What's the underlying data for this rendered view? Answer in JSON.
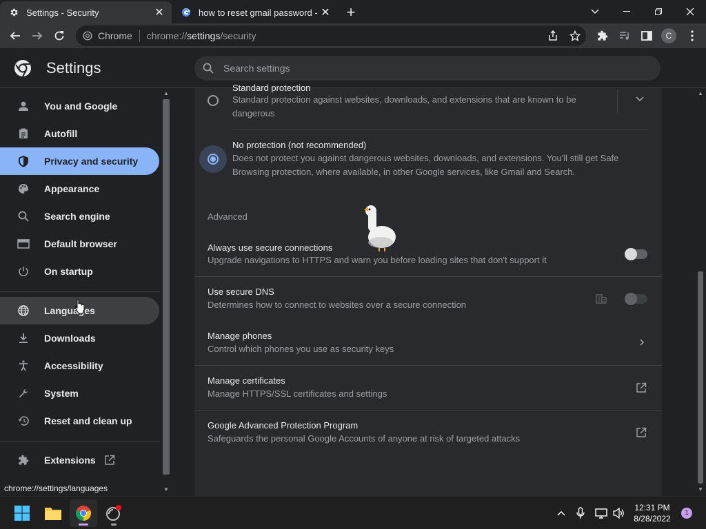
{
  "tabs": [
    {
      "title": "Settings - Security",
      "icon": "gear-icon"
    },
    {
      "title": "how to reset gmail password - Go",
      "icon": "google-icon"
    }
  ],
  "omnibox": {
    "site": "Chrome",
    "url_prefix": "chrome://",
    "url_host": "settings",
    "url_path": "/security"
  },
  "profile": {
    "initial": "C"
  },
  "header": {
    "title": "Settings",
    "search_placeholder": "Search settings"
  },
  "sidebar": {
    "items": [
      {
        "label": "You and Google",
        "icon": "person-icon"
      },
      {
        "label": "Autofill",
        "icon": "clipboard-icon"
      },
      {
        "label": "Privacy and security",
        "icon": "shield-icon"
      },
      {
        "label": "Appearance",
        "icon": "palette-icon"
      },
      {
        "label": "Search engine",
        "icon": "search-icon"
      },
      {
        "label": "Default browser",
        "icon": "browser-icon"
      },
      {
        "label": "On startup",
        "icon": "power-icon"
      },
      {
        "label": "Languages",
        "icon": "globe-icon"
      },
      {
        "label": "Downloads",
        "icon": "download-icon"
      },
      {
        "label": "Accessibility",
        "icon": "accessibility-icon"
      },
      {
        "label": "System",
        "icon": "wrench-icon"
      },
      {
        "label": "Reset and clean up",
        "icon": "history-icon"
      },
      {
        "label": "Extensions",
        "icon": "puzzle-icon"
      }
    ]
  },
  "content": {
    "standard": {
      "title": "Standard protection",
      "sub1": "Standard protection against websites, downloads, and extensions that are known to be",
      "sub2": "dangerous"
    },
    "no_protection": {
      "title": "No protection (not recommended)",
      "sub1": "Does not protect you against dangerous websites, downloads, and extensions. You'll still get Safe",
      "sub2": "Browsing protection, where available, in other Google services, like Gmail and Search."
    },
    "advanced_label": "Advanced",
    "secure_connections": {
      "title": "Always use secure connections",
      "sub": "Upgrade navigations to HTTPS and warn you before loading sites that don't support it",
      "enabled": false
    },
    "secure_dns": {
      "title": "Use secure DNS",
      "sub": "Determines how to connect to websites over a secure connection",
      "enabled": false
    },
    "manage_phones": {
      "title": "Manage phones",
      "sub": "Control which phones you use as security keys"
    },
    "manage_certificates": {
      "title": "Manage certificates",
      "sub": "Manage HTTPS/SSL certificates and settings"
    },
    "advanced_protection": {
      "title": "Google Advanced Protection Program",
      "sub": "Safeguards the personal Google Accounts of anyone at risk of targeted attacks"
    }
  },
  "status_url": "chrome://settings/languages",
  "taskbar": {
    "time": "12:31 PM",
    "date": "8/28/2022",
    "notification_count": "1"
  },
  "colors": {
    "accent": "#8ab4f8",
    "background": "#202124",
    "card": "#292a2d"
  }
}
